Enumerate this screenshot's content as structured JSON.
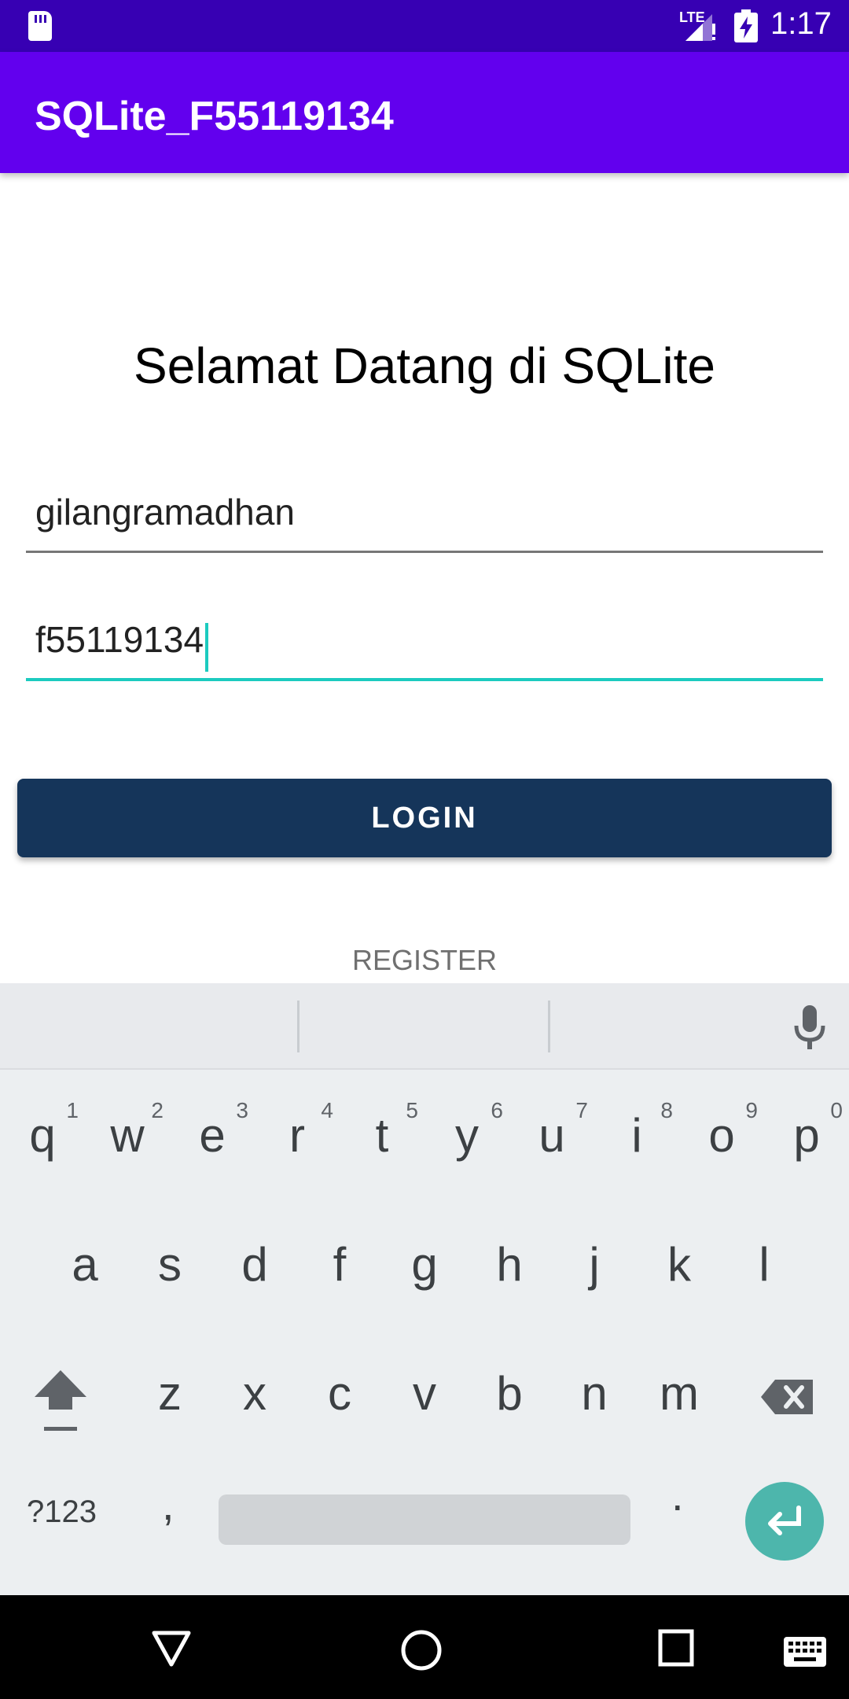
{
  "status_bar": {
    "network": "LTE",
    "time": "1:17"
  },
  "app_bar": {
    "title": "SQLite_F55119134"
  },
  "main": {
    "heading": "Selamat Datang di SQLite",
    "username_value": "gilangramadhan",
    "password_value": "f55119134",
    "login_label": "LOGIN",
    "register_label": "REGISTER"
  },
  "keyboard": {
    "row1": [
      "q",
      "w",
      "e",
      "r",
      "t",
      "y",
      "u",
      "i",
      "o",
      "p"
    ],
    "row1_hints": [
      "1",
      "2",
      "3",
      "4",
      "5",
      "6",
      "7",
      "8",
      "9",
      "0"
    ],
    "row2": [
      "a",
      "s",
      "d",
      "f",
      "g",
      "h",
      "j",
      "k",
      "l"
    ],
    "row3": [
      "z",
      "x",
      "c",
      "v",
      "b",
      "n",
      "m"
    ],
    "symbols_label": "?123",
    "comma": ",",
    "period": "."
  },
  "colors": {
    "status_bar": "#3700B3",
    "app_bar": "#6200EE",
    "login_button": "#15355a",
    "accent": "#1ccbbf",
    "enter_key": "#4db6ac"
  },
  "icons": {
    "status": [
      "sd-card-icon",
      "signal-icon",
      "battery-charging-icon"
    ],
    "keyboard": [
      "mic-icon",
      "shift-icon",
      "backspace-icon",
      "enter-icon"
    ],
    "navigation": [
      "back-icon",
      "home-icon",
      "recents-icon",
      "keyboard-switch-icon"
    ]
  }
}
